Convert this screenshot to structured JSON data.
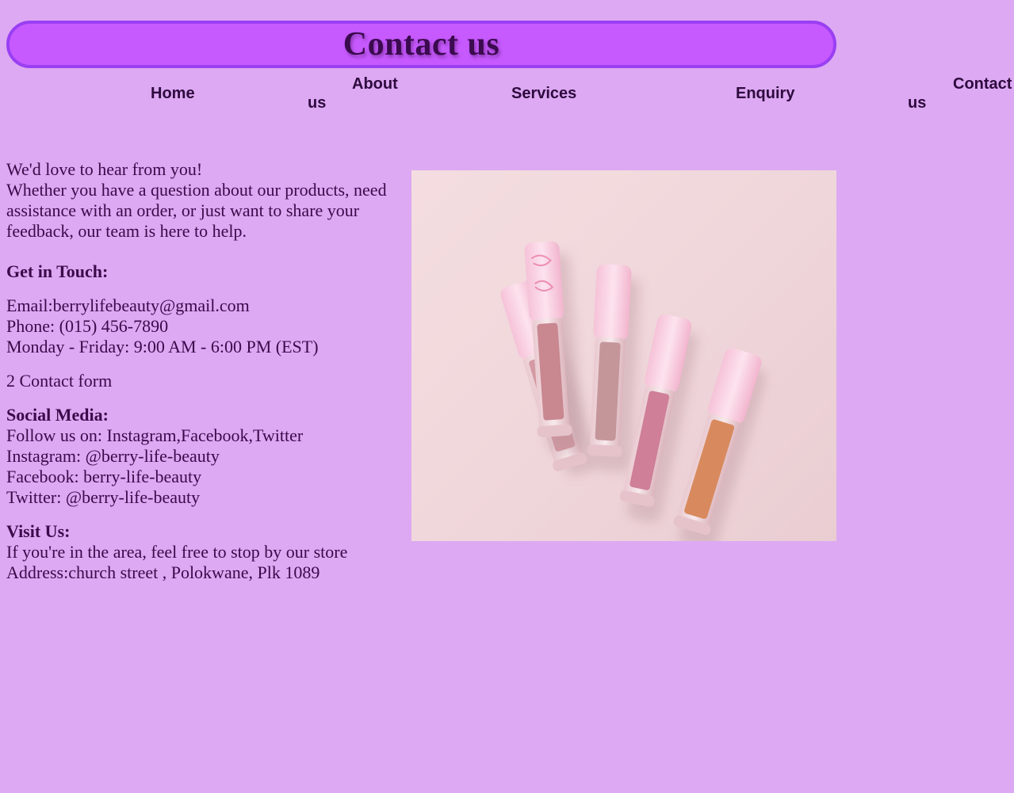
{
  "header": {
    "title": "Contact us"
  },
  "nav": {
    "home": "Home",
    "about_top": "About",
    "about_bottom": "us",
    "services": "Services",
    "enquiry": "Enquiry",
    "contact_top": "Contact",
    "contact_bottom": "us"
  },
  "intro": {
    "line1": "We'd love to hear from you!",
    "line2": "Whether you have a question about our products, need assistance with an order, or just want to share your feedback, our team is here to help."
  },
  "get_in_touch": {
    "heading": "Get in Touch:",
    "email": "Email:berrylifebeauty@gmail.com",
    "phone": "Phone: (015) 456-7890",
    "hours": "Monday - Friday: 9:00 AM - 6:00 PM (EST)"
  },
  "contact_form": {
    "label": "2 Contact form"
  },
  "social": {
    "heading": "Social Media:",
    "follow": "Follow us on: Instagram,Facebook,Twitter",
    "instagram": "Instagram: @berry-life-beauty",
    "facebook": "Facebook: berry-life-beauty",
    "twitter": "Twitter: @berry-life-beauty"
  },
  "visit": {
    "heading": "Visit Us:",
    "text": "If you're in the area, feel free to stop by our store",
    "address": "Address:church street , Polokwane, Plk 1089"
  },
  "colors": {
    "background": "#dda9f3",
    "banner_fill": "#c75aff",
    "banner_border": "#9a3ff2",
    "text": "#3a0a4a"
  }
}
